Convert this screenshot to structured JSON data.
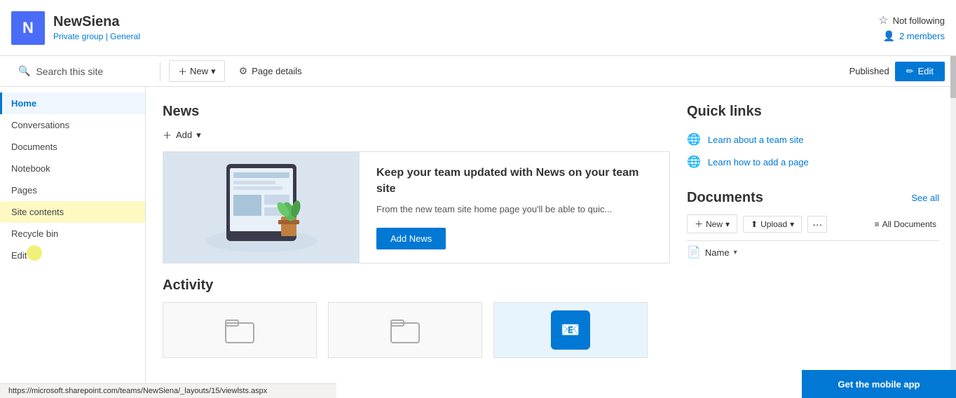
{
  "site": {
    "initial": "N",
    "name": "NewSiena",
    "meta_private": "Private group",
    "meta_separator": " | ",
    "meta_general": "General"
  },
  "top_bar": {
    "follow_label": "Not following",
    "members_label": "2 members"
  },
  "toolbar": {
    "search_placeholder": "Search this site",
    "new_label": "New",
    "page_details_label": "Page details",
    "published_label": "Published",
    "edit_label": "Edit"
  },
  "sidebar": {
    "items": [
      {
        "label": "Home",
        "active": true
      },
      {
        "label": "Conversations",
        "active": false
      },
      {
        "label": "Documents",
        "active": false
      },
      {
        "label": "Notebook",
        "active": false
      },
      {
        "label": "Pages",
        "active": false
      },
      {
        "label": "Site contents",
        "active": false,
        "cursor": true
      },
      {
        "label": "Recycle bin",
        "active": false
      },
      {
        "label": "Edit",
        "active": false
      }
    ]
  },
  "news": {
    "title": "News",
    "add_label": "Add",
    "headline": "Keep your team updated with News on your team site",
    "description": "From the new team site home page you'll be able to quic...",
    "add_news_label": "Add News"
  },
  "activity": {
    "title": "Activity"
  },
  "quick_links": {
    "title": "Quick links",
    "items": [
      {
        "label": "Learn about a team site"
      },
      {
        "label": "Learn how to add a page"
      }
    ]
  },
  "documents": {
    "title": "Documents",
    "see_all_label": "See all",
    "new_label": "New",
    "upload_label": "Upload",
    "all_docs_label": "All Documents",
    "name_col": "Name"
  },
  "mobile_banner": {
    "label": "Get the mobile app"
  },
  "status_bar": {
    "url": "https://microsoft.sharepoint.com/teams/NewSiena/_layouts/15/viewlsts.aspx"
  }
}
